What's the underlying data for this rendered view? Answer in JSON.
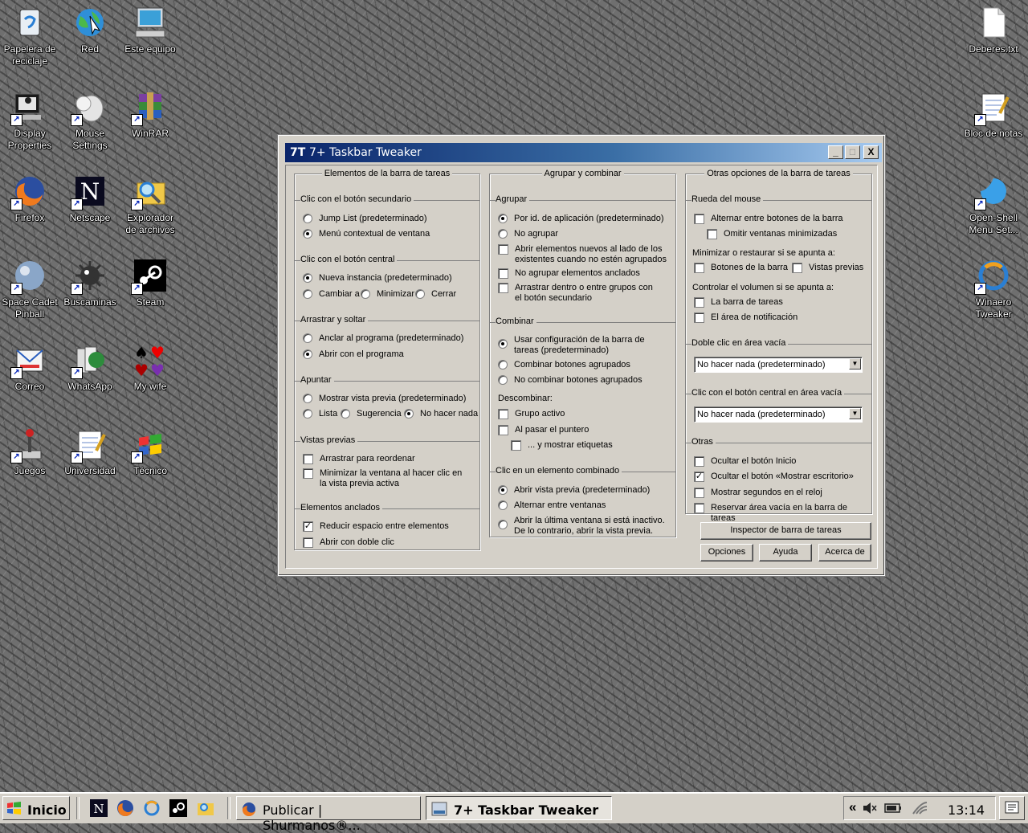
{
  "desktop": {
    "icons": [
      {
        "label": "Papelera de reciclaje"
      },
      {
        "label": "Red"
      },
      {
        "label": "Este equipo"
      },
      {
        "label": "Display Properties"
      },
      {
        "label": "Mouse Settings"
      },
      {
        "label": "WinRAR"
      },
      {
        "label": "Firefox"
      },
      {
        "label": "Netscape"
      },
      {
        "label": "Explorador de archivos"
      },
      {
        "label": "Space Cadet Pinball"
      },
      {
        "label": "Buscaminas"
      },
      {
        "label": "Steam"
      },
      {
        "label": "Correo"
      },
      {
        "label": "WhatsApp"
      },
      {
        "label": "My wife"
      },
      {
        "label": "Juegos"
      },
      {
        "label": "Universidad"
      },
      {
        "label": "Técnico"
      },
      {
        "label": "Deberes.txt"
      },
      {
        "label": "Bloc de notas"
      },
      {
        "label": "Open-Shell Menu Set..."
      },
      {
        "label": "Winaero Tweaker"
      }
    ]
  },
  "window": {
    "logo": "7T",
    "title": "7+ Taskbar Tweaker",
    "minimize": "_",
    "maximize": "□",
    "close": "X",
    "col1": {
      "title": "Elementos de la barra de tareas",
      "g1": {
        "label": "Clic con el botón secundario",
        "o1": "Jump List (predeterminado)",
        "o2": "Menú contextual de ventana"
      },
      "g2": {
        "label": "Clic con el botón central",
        "o1": "Nueva instancia (predeterminado)",
        "o2": "Cambiar a",
        "o3": "Minimizar",
        "o4": "Cerrar"
      },
      "g3": {
        "label": "Arrastrar y soltar",
        "o1": "Anclar al programa (predeterminado)",
        "o2": "Abrir con el programa"
      },
      "g4": {
        "label": "Apuntar",
        "o1": "Mostrar vista previa (predeterminado)",
        "o2": "Lista",
        "o3": "Sugerencia",
        "o4": "No hacer nada"
      },
      "g5": {
        "label": "Vistas previas",
        "o1": "Arrastrar para reordenar",
        "o2": "Minimizar la ventana al hacer clic en la vista previa activa"
      },
      "g6": {
        "label": "Elementos anclados",
        "o1": "Reducir espacio entre elementos",
        "o2": "Abrir con doble clic"
      }
    },
    "col2": {
      "title": "Agrupar y combinar",
      "g1": {
        "label": "Agrupar",
        "o1": "Por id. de aplicación (predeterminado)",
        "o2": "No agrupar",
        "o3": "Abrir elementos nuevos al lado de los existentes cuando no estén agrupados",
        "o4": "No agrupar elementos anclados",
        "o5": "Arrastrar dentro o entre grupos con el botón secundario"
      },
      "g2": {
        "label": "Combinar",
        "o1": "Usar configuración de la barra de tareas (predeterminado)",
        "o2": "Combinar botones agrupados",
        "o3": "No combinar botones agrupados",
        "sub": "Descombinar:",
        "o4": "Grupo activo",
        "o5": "Al pasar el puntero",
        "o6": "... y mostrar etiquetas"
      },
      "g3": {
        "label": "Clic en un elemento combinado",
        "o1": "Abrir vista previa (predeterminado)",
        "o2": "Alternar entre ventanas",
        "o3": "Abrir la última ventana si está inactivo. De lo contrario, abrir la vista previa."
      }
    },
    "col3": {
      "title": "Otras opciones de la barra de tareas",
      "g1": {
        "label": "Rueda del mouse",
        "o1": "Alternar entre botones de la barra",
        "o2": "Omitir ventanas minimizadas",
        "sub1": "Minimizar o restaurar si se apunta a:",
        "o3": "Botones de la barra",
        "o4": "Vistas previas",
        "sub2": "Controlar el volumen si se apunta a:",
        "o5": "La barra de tareas",
        "o6": "El área de notificación"
      },
      "g2": {
        "label": "Doble clic en área vacía",
        "value": "No hacer nada (predeterminado)"
      },
      "g3": {
        "label": "Clic con el botón central en área vacía",
        "value": "No hacer nada (predeterminado)"
      },
      "g4": {
        "label": "Otras",
        "o1": "Ocultar el botón Inicio",
        "o2": "Ocultar el botón «Mostrar escritorio»",
        "o3": "Mostrar segundos en el reloj",
        "o4": "Reservar área vacía en la barra de tareas"
      },
      "inspector": "Inspector de barra de tareas",
      "options": "Opciones",
      "help": "Ayuda",
      "about": "Acerca de"
    }
  },
  "taskbar": {
    "start": "Inicio",
    "quick": [
      "netscape-icon",
      "firefox-icon",
      "winaero-icon",
      "steam-icon",
      "explorer-icon"
    ],
    "task1": "Publicar | Shurmanos®...",
    "task2": "7+ Taskbar Tweaker",
    "tray_chevron": "«",
    "clock": "13:14"
  }
}
